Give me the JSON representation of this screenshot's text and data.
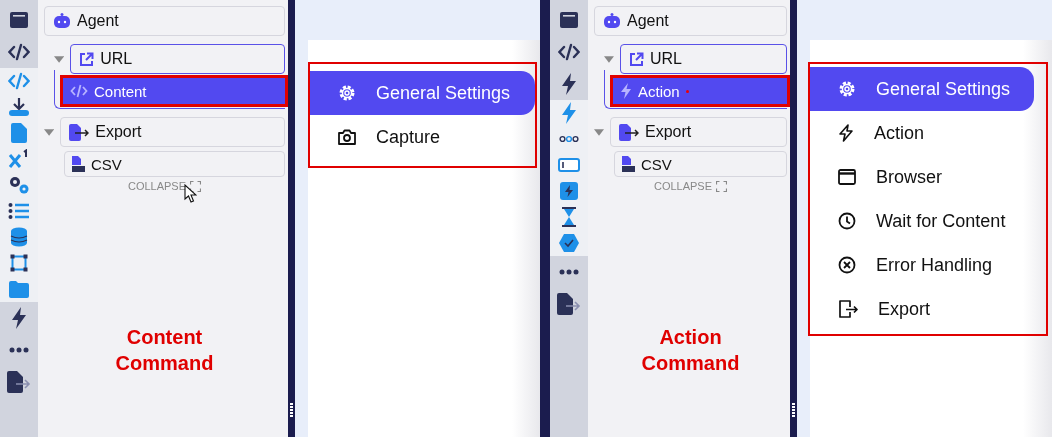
{
  "panels": [
    {
      "toolbar": [
        {
          "kind": "browser",
          "grouped": false
        },
        {
          "kind": "code",
          "grouped": false
        },
        {
          "kind": "code",
          "grouped": true
        },
        {
          "kind": "download",
          "grouped": true
        },
        {
          "kind": "file",
          "grouped": true
        },
        {
          "kind": "superscript",
          "grouped": true
        },
        {
          "kind": "gears",
          "grouped": true
        },
        {
          "kind": "list",
          "grouped": true
        },
        {
          "kind": "database",
          "grouped": true
        },
        {
          "kind": "nodes",
          "grouped": true
        },
        {
          "kind": "folder",
          "grouped": true
        },
        {
          "kind": "bolt",
          "grouped": false
        },
        {
          "kind": "dots",
          "grouped": false
        },
        {
          "kind": "export",
          "grouped": false
        }
      ],
      "agent": "Agent",
      "nodes": [
        {
          "label": "URL",
          "kind": "link",
          "active": true,
          "expanded": true,
          "children": [
            {
              "label": "Content",
              "kind": "code",
              "selected": true,
              "annotated": true,
              "marker": false
            }
          ]
        },
        {
          "label": "Export",
          "kind": "export",
          "active": false,
          "expanded": true,
          "children": [
            {
              "label": "CSV",
              "kind": "csv",
              "selected": false,
              "annotated": false,
              "marker": false
            }
          ]
        }
      ],
      "collapse_button": "COLLAPSE",
      "cursor": true,
      "menu_annotated": true,
      "menu": [
        {
          "kind": "gear",
          "label": "General Settings",
          "selected": true
        },
        {
          "kind": "camera",
          "label": "Capture",
          "selected": false
        }
      ],
      "caption": "Content Command"
    },
    {
      "toolbar": [
        {
          "kind": "browser",
          "grouped": false
        },
        {
          "kind": "code",
          "grouped": false
        },
        {
          "kind": "bolt",
          "grouped": false
        },
        {
          "kind": "bolt",
          "grouped": true
        },
        {
          "kind": "ring-dots",
          "grouped": true
        },
        {
          "kind": "input",
          "grouped": true
        },
        {
          "kind": "bolt-square",
          "grouped": true
        },
        {
          "kind": "hourglass",
          "grouped": true
        },
        {
          "kind": "check-badge",
          "grouped": true
        },
        {
          "kind": "dots",
          "grouped": false
        },
        {
          "kind": "export",
          "grouped": false
        }
      ],
      "agent": "Agent",
      "nodes": [
        {
          "label": "URL",
          "kind": "link",
          "active": true,
          "expanded": true,
          "children": [
            {
              "label": "Action",
              "kind": "bolt",
              "selected": true,
              "annotated": true,
              "marker": true
            }
          ]
        },
        {
          "label": "Export",
          "kind": "export",
          "active": false,
          "expanded": true,
          "children": [
            {
              "label": "CSV",
              "kind": "csv",
              "selected": false,
              "annotated": false,
              "marker": false
            }
          ]
        }
      ],
      "collapse_button": "COLLAPSE",
      "menu_annotated": true,
      "menu": [
        {
          "kind": "gear",
          "label": "General Settings",
          "selected": true
        },
        {
          "kind": "bolt",
          "label": "Action",
          "selected": false
        },
        {
          "kind": "browser",
          "label": "Browser",
          "selected": false
        },
        {
          "kind": "clock",
          "label": "Wait for Content",
          "selected": false
        },
        {
          "kind": "x-circle",
          "label": "Error Handling",
          "selected": false
        },
        {
          "kind": "export",
          "label": "Export",
          "selected": false
        }
      ],
      "caption": "Action Command"
    }
  ]
}
